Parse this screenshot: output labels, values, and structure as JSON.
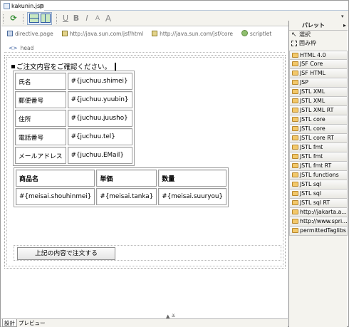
{
  "editor": {
    "tab_title": "kakunin.jsp",
    "tab_close": "⊠"
  },
  "toolbar": {
    "refresh_icon": "refresh-icon",
    "format_buttons": [
      "U",
      "B",
      "I",
      "A",
      "A"
    ]
  },
  "taglibs": [
    {
      "label": "directive.page",
      "icon": "directive-icon"
    },
    {
      "label": "http://java.sun.com/jsf/html",
      "icon": "taglib-icon"
    },
    {
      "label": "http://java.sun.com/jsf/core",
      "icon": "taglib-icon"
    },
    {
      "label": "scriptlet",
      "icon": "scriptlet-icon"
    }
  ],
  "head": {
    "label": "head"
  },
  "page": {
    "confirm_text": "ご注文内容をご確認ください。",
    "customer_table": [
      {
        "label": "氏名",
        "value": "#{juchuu.shimei}"
      },
      {
        "label": "郵便番号",
        "value": "#{juchuu.yuubin}"
      },
      {
        "label": "住所",
        "value": "#{juchuu.juusho}"
      },
      {
        "label": "電話番号",
        "value": "#{juchuu.tel}"
      },
      {
        "label": "メールアドレス",
        "value": "#{juchuu.EMail}"
      }
    ],
    "detail_table": {
      "headers": [
        "商品名",
        "単価",
        "数量"
      ],
      "rows": [
        [
          "#{meisai.shouhinmei}",
          "#{meisai.tanka}",
          "#{meisai.suuryou}"
        ]
      ]
    },
    "order_button": "上記の内容で注文する"
  },
  "bottom_tabs": [
    "設計",
    "プレビュー"
  ],
  "palette": {
    "title": "パレット",
    "tools": [
      "選択",
      "囲み枠"
    ],
    "drawers": [
      "HTML 4.0",
      "JSF Core",
      "JSF HTML",
      "JSP",
      "JSTL XML",
      "JSTL XML",
      "JSTL XML RT",
      "JSTL core",
      "JSTL core",
      "JSTL core RT",
      "JSTL fmt",
      "JSTL fmt",
      "JSTL fmt RT",
      "JSTL functions",
      "JSTL sql",
      "JSTL sql",
      "JSTL sql RT",
      "http://jakarta.a...",
      "http://www.spri...",
      "permittedTaglibs"
    ]
  }
}
